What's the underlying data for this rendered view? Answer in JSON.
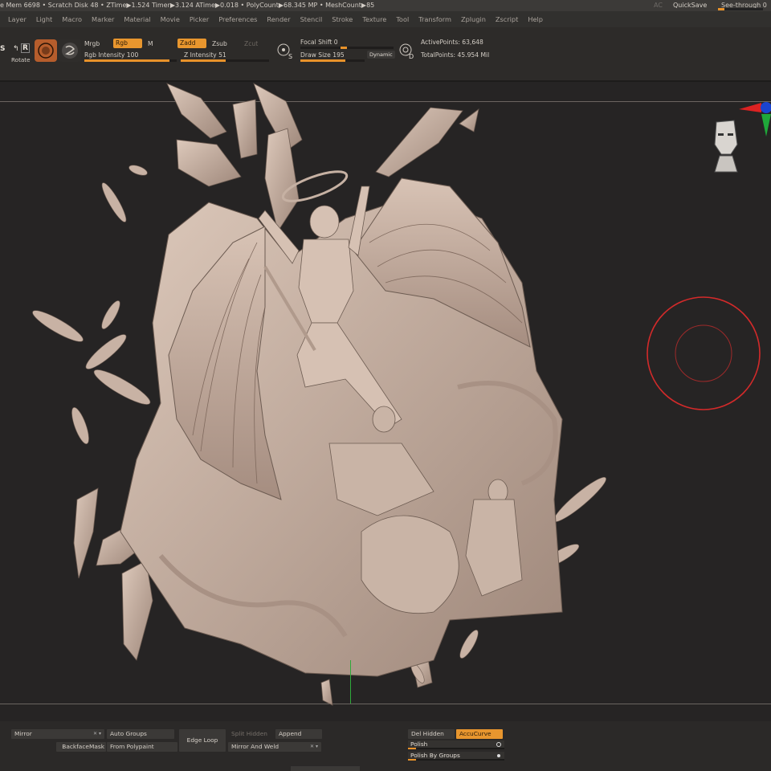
{
  "status_bar": {
    "text": "e Mem 6698 • Scratch Disk 48 •  ZTime▶1.524 Timer▶3.124 ATime▶0.018 • PolyCount▶68.345 MP  • MeshCount▶85",
    "ac_label": "AC",
    "quicksave": "QuickSave",
    "see_through": "See-through  0",
    "accent_color": "#e8922a"
  },
  "menu": [
    "Layer",
    "Light",
    "Macro",
    "Marker",
    "Material",
    "Movie",
    "Picker",
    "Preferences",
    "Render",
    "Stencil",
    "Stroke",
    "Texture",
    "Tool",
    "Transform",
    "Zplugin",
    "Zscript",
    "Help"
  ],
  "shelf": {
    "scale_label": "S",
    "rotate_label": "Rotate",
    "rotate_key": "R",
    "mrgb": "Mrgb",
    "rgb": "Rgb",
    "m": "M",
    "rgb_intensity": "Rgb Intensity 100",
    "zadd": "Zadd",
    "zsub": "Zsub",
    "zcut": "Zcut",
    "z_intensity": "Z Intensity 51",
    "focal_shift": "Focal Shift 0",
    "draw_size": "Draw Size 195",
    "dynamic": "Dynamic",
    "s_key": "S",
    "d_key": "D",
    "active_points": "ActivePoints: 63,648",
    "total_points": "TotalPoints: 45.954 Mil",
    "rgb_intensity_value": 100,
    "z_intensity_value": 51,
    "focal_shift_value": 0,
    "draw_size_value": 195
  },
  "canvas": {
    "background": "#262424",
    "model_color": "#c9b4a6",
    "brush_color": "#d32a2a",
    "gizmo_icons": [
      "navigation-head-icon",
      "axis-gizmo-icon",
      "brush-cursor-icon"
    ]
  },
  "bottom": {
    "mirror": "Mirror",
    "backface_mask": "BackfaceMask",
    "auto_groups": "Auto Groups",
    "from_polypaint": "From Polypaint",
    "edge_loop": "Edge Loop",
    "split_hidden": "Split Hidden",
    "append": "Append",
    "mirror_and_weld": "Mirror And Weld",
    "del_hidden": "Del Hidden",
    "accucurve": "AccuCurve",
    "polish": "Polish",
    "polish_by_groups": "Polish By Groups"
  }
}
